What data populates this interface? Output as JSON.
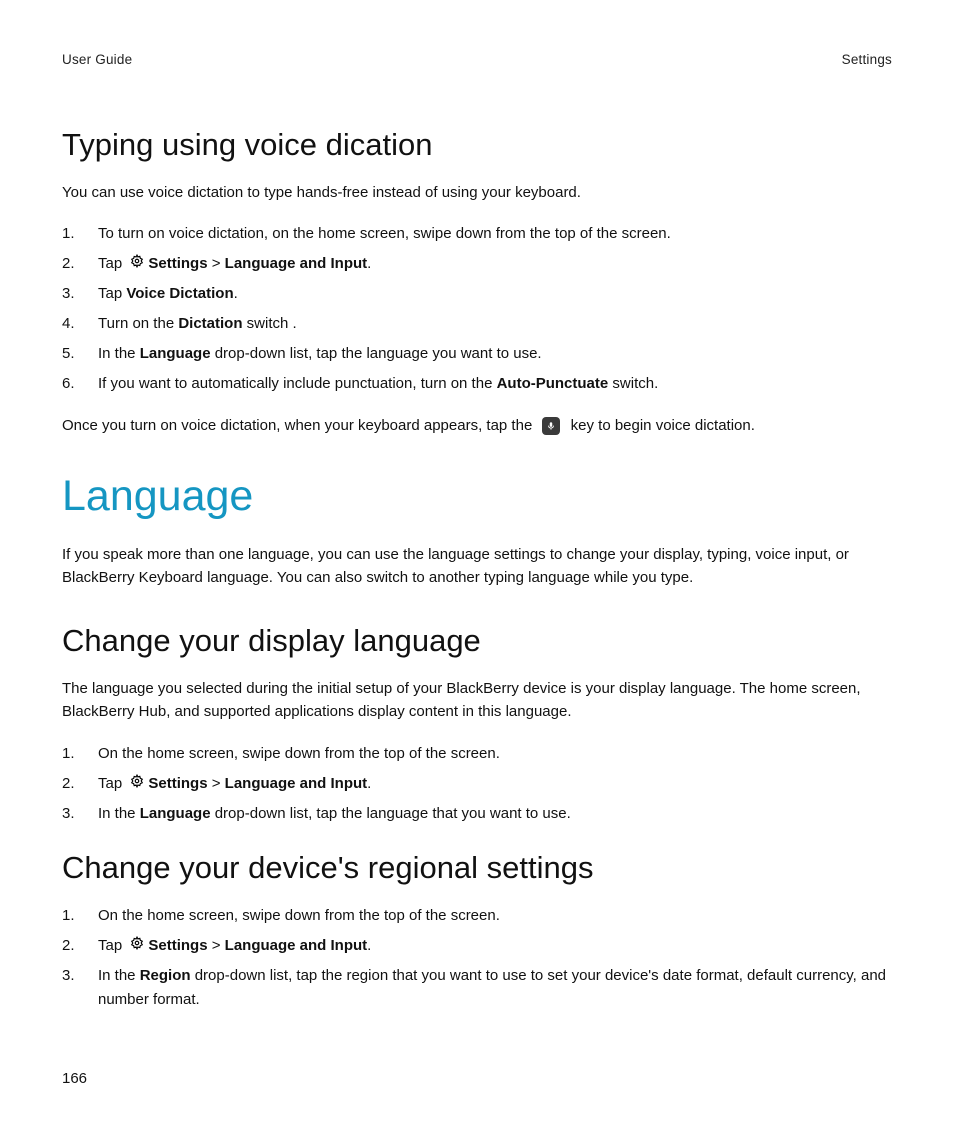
{
  "header": {
    "left": "User Guide",
    "right": "Settings"
  },
  "section1": {
    "title": "Typing using voice dication",
    "intro": "You can use voice dictation to type hands-free instead of using your keyboard.",
    "steps": {
      "s1": "To turn on voice dictation, on the home screen, swipe down from the top of the screen.",
      "s2_tap": "Tap ",
      "s2_settings": "Settings",
      "s2_sep": " > ",
      "s2_lang": "Language and Input",
      "s2_end": ".",
      "s3_a": "Tap ",
      "s3_b": "Voice Dictation",
      "s3_c": ".",
      "s4_a": "Turn on the ",
      "s4_b": "Dictation",
      "s4_c": " switch .",
      "s5_a": "In the ",
      "s5_b": "Language",
      "s5_c": " drop-down list, tap the language you want to use.",
      "s6_a": "If you want to automatically include punctuation, turn on the ",
      "s6_b": "Auto-Punctuate",
      "s6_c": " switch."
    },
    "outro_a": "Once you turn on voice dictation, when your keyboard appears, tap the ",
    "outro_b": " key to begin voice dictation."
  },
  "major": {
    "title": "Language",
    "intro": "If you speak more than one language, you can use the language settings to change your display, typing, voice input, or BlackBerry Keyboard language. You can also switch to another typing language while you type."
  },
  "section2": {
    "title": "Change your display language",
    "intro": "The language you selected during the initial setup of your BlackBerry device is your display language. The home screen, BlackBerry Hub, and supported applications display content in this language.",
    "steps": {
      "s1": "On the home screen, swipe down from the top of the screen.",
      "s2_tap": "Tap ",
      "s2_settings": "Settings",
      "s2_sep": " > ",
      "s2_lang": "Language and Input",
      "s2_end": ".",
      "s3_a": "In the ",
      "s3_b": "Language",
      "s3_c": " drop-down list, tap the language that you want to use."
    }
  },
  "section3": {
    "title": "Change your device's regional settings",
    "steps": {
      "s1": "On the home screen, swipe down from the top of the screen.",
      "s2_tap": "Tap ",
      "s2_settings": "Settings",
      "s2_sep": " > ",
      "s2_lang": "Language and Input",
      "s2_end": ".",
      "s3_a": "In the ",
      "s3_b": "Region",
      "s3_c": " drop-down list, tap the region that you want to use to set your device's date format, default currency, and number format."
    }
  },
  "nums": {
    "n1": "1.",
    "n2": "2.",
    "n3": "3.",
    "n4": "4.",
    "n5": "5.",
    "n6": "6."
  },
  "pageNumber": "166"
}
